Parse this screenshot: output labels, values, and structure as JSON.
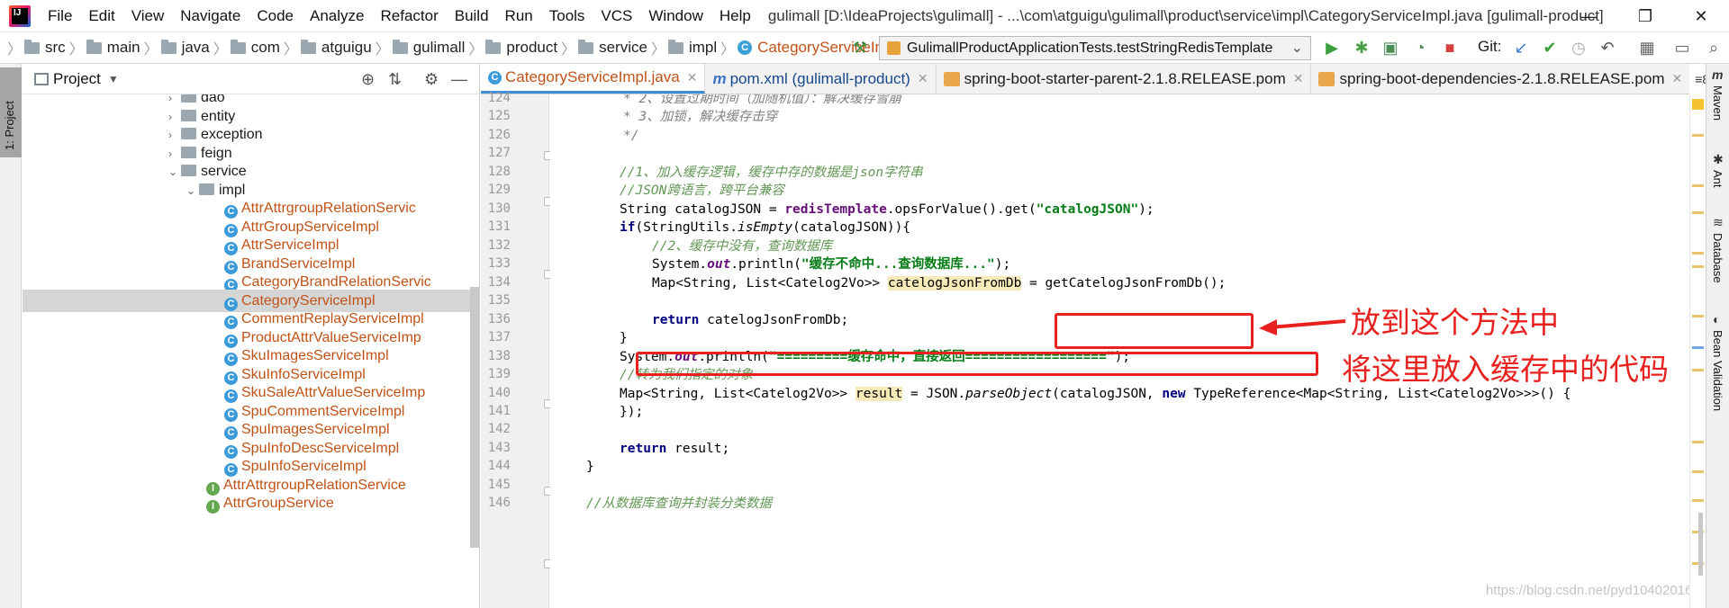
{
  "window": {
    "title": "gulimall [D:\\IdeaProjects\\gulimall] - ...\\com\\atguigu\\gulimall\\product\\service\\impl\\CategoryServiceImpl.java [gulimall-product]",
    "controls": [
      "—",
      "❐",
      "✕"
    ]
  },
  "menu": [
    "File",
    "Edit",
    "View",
    "Navigate",
    "Code",
    "Analyze",
    "Refactor",
    "Build",
    "Run",
    "Tools",
    "VCS",
    "Window",
    "Help"
  ],
  "breadcrumb": [
    "src",
    "main",
    "java",
    "com",
    "atguigu",
    "gulimall",
    "product",
    "service",
    "impl",
    "CategoryServiceImpl"
  ],
  "run_config": "GulimallProductApplicationTests.testStringRedisTemplate",
  "git_label": "Git:",
  "project": {
    "title": "Project",
    "tree": [
      {
        "label": "dao",
        "kind": "folder",
        "arrow": "›"
      },
      {
        "label": "entity",
        "kind": "folder",
        "arrow": "›"
      },
      {
        "label": "exception",
        "kind": "folder",
        "arrow": "›"
      },
      {
        "label": "feign",
        "kind": "folder",
        "arrow": "›"
      },
      {
        "label": "service",
        "kind": "folder",
        "arrow": "⌄"
      },
      {
        "label": "impl",
        "kind": "folder",
        "arrow": "⌄"
      },
      {
        "label": "AttrAttrgroupRelationServic",
        "kind": "class"
      },
      {
        "label": "AttrGroupServiceImpl",
        "kind": "class"
      },
      {
        "label": "AttrServiceImpl",
        "kind": "class"
      },
      {
        "label": "BrandServiceImpl",
        "kind": "class"
      },
      {
        "label": "CategoryBrandRelationServic",
        "kind": "class"
      },
      {
        "label": "CategoryServiceImpl",
        "kind": "class",
        "selected": true
      },
      {
        "label": "CommentReplayServiceImpl",
        "kind": "class"
      },
      {
        "label": "ProductAttrValueServiceImp",
        "kind": "class"
      },
      {
        "label": "SkuImagesServiceImpl",
        "kind": "class"
      },
      {
        "label": "SkuInfoServiceImpl",
        "kind": "class"
      },
      {
        "label": "SkuSaleAttrValueServiceImp",
        "kind": "class"
      },
      {
        "label": "SpuCommentServiceImpl",
        "kind": "class"
      },
      {
        "label": "SpuImagesServiceImpl",
        "kind": "class"
      },
      {
        "label": "SpuInfoDescServiceImpl",
        "kind": "class"
      },
      {
        "label": "SpuInfoServiceImpl",
        "kind": "class"
      },
      {
        "label": "AttrAttrgroupRelationService",
        "kind": "interface"
      },
      {
        "label": "AttrGroupService",
        "kind": "interface"
      }
    ]
  },
  "tabs": [
    {
      "label": "CategoryServiceImpl.java",
      "icon": "class-icon",
      "active": true
    },
    {
      "label": "pom.xml (gulimall-product)",
      "icon": "maven-icon"
    },
    {
      "label": "spring-boot-starter-parent-2.1.8.RELEASE.pom",
      "icon": "xml-icon"
    },
    {
      "label": "spring-boot-dependencies-2.1.8.RELEASE.pom",
      "icon": "xml-icon"
    }
  ],
  "tab_overflow": "≡8",
  "line_numbers": [
    "124",
    "125",
    "126",
    "127",
    "128",
    "129",
    "130",
    "131",
    "132",
    "133",
    "134",
    "135",
    "136",
    "137",
    "138",
    "139",
    "140",
    "141",
    "142",
    "143",
    "144",
    "145",
    "146"
  ],
  "code": {
    "l124": "* 2、设置过期时间（加随机值）：解决缓存雪崩",
    "l125": "* 3、加锁，解决缓存击穿",
    "l126": "*/",
    "l128": "//1、加入缓存逻辑，缓存中存的数据是json字符串",
    "l129": "//JSON跨语言，跨平台兼容",
    "l130": [
      "String catalogJSON = ",
      "redisTemplate",
      ".opsForValue().get(",
      "\"catalogJSON\"",
      ");"
    ],
    "l131": [
      "if",
      "(StringUtils.",
      "isEmpty",
      "(catalogJSON)){"
    ],
    "l132": "//2、缓存中没有，查询数据库",
    "l133": [
      "System.",
      "out",
      ".println(",
      "\"缓存不命中...查询数据库...\"",
      ");"
    ],
    "l134": [
      "Map<String, List<Catelog2Vo>> ",
      "catelogJsonFromDb",
      " = ",
      "getCatelogJsonFromDb",
      "();"
    ],
    "l136": [
      "return",
      " catelogJsonFromDb;"
    ],
    "l137": "}",
    "l138": [
      "System.",
      "out",
      ".println(",
      "\"=========缓存命中，直接返回==================\"",
      ");"
    ],
    "l139": "//转为我们指定的对象",
    "l140": [
      "Map<String, List<Catelog2Vo>> ",
      "result",
      " = JSON.",
      "parseObject",
      "(catalogJSON, ",
      "new",
      " TypeReference<Map<String, List<Catelog2Vo>>>() {"
    ],
    "l141": "});",
    "l143": [
      "return",
      " result;"
    ],
    "l144": "}",
    "l146": "//从数据库查询并封装分类数据"
  },
  "annotations": {
    "first": "放到这个方法中",
    "second": "将这里放入缓存中的代码"
  },
  "watermark": "https://blog.csdn.net/pyd1040201698",
  "right_tabs": [
    "Maven",
    "Ant",
    "Database",
    "Bean Validation"
  ],
  "colors": {
    "annotation_red": "#e8211e",
    "comment_green": "#629755",
    "keyword": "#000080",
    "string": "#067d17",
    "field": "#660e7a",
    "active_tab_accent": "#3f8fd8"
  }
}
